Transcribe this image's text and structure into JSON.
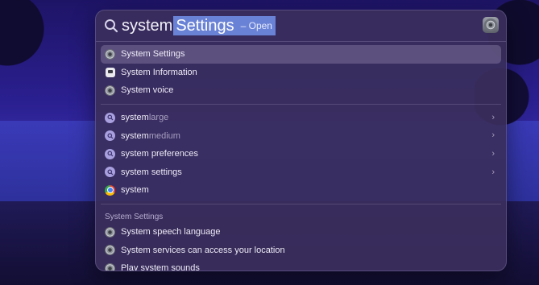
{
  "search": {
    "typed": "system",
    "completion": "Settings",
    "completion_suffix": "– Open"
  },
  "top_hits": [
    {
      "label": "System Settings",
      "icon": "system-settings-gear-icon",
      "selected": true
    },
    {
      "label": "System Information",
      "icon": "system-information-icon"
    },
    {
      "label": "System voice",
      "icon": "system-settings-gear-icon"
    }
  ],
  "suggestions": [
    {
      "label_main": "system",
      "label_rest": "large",
      "icon": "search-suggestion-icon",
      "chevron": true
    },
    {
      "label_main": "system",
      "label_rest": "medium",
      "icon": "search-suggestion-icon",
      "chevron": true
    },
    {
      "label_main": "system preferences",
      "label_rest": "",
      "icon": "search-suggestion-icon",
      "chevron": true
    },
    {
      "label_main": "system settings",
      "label_rest": "",
      "icon": "search-suggestion-icon",
      "chevron": true
    },
    {
      "label_main": "system",
      "label_rest": "",
      "icon": "chrome-icon",
      "chevron": false
    }
  ],
  "settings_section": {
    "title": "System Settings",
    "items": [
      {
        "label": "System speech language",
        "icon": "system-settings-gear-icon"
      },
      {
        "label": "System services can access your location",
        "icon": "system-settings-gear-icon"
      },
      {
        "label": "Play system sounds",
        "icon": "system-settings-gear-icon"
      }
    ]
  },
  "colors": {
    "panel_bg": "#3a2e5c",
    "completion_highlight": "#6a82d6",
    "wallpaper": "#2a1f8f"
  }
}
